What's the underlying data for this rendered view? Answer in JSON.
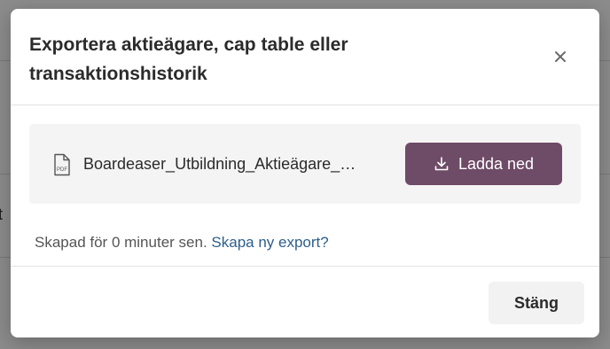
{
  "background": {
    "partial_text": "t"
  },
  "dialog": {
    "title": "Exportera aktieägare, cap table eller transaktionshistorik",
    "close_icon": "close-icon"
  },
  "file": {
    "name": "Boardeaser_Utbildning_Aktieägare_…",
    "icon": "pdf-file-icon",
    "icon_label": "PDF",
    "download_label": "Ladda ned",
    "download_icon": "download-icon"
  },
  "status": {
    "created_text": "Skapad för 0 minuter sen.",
    "new_export_link": "Skapa ny export?"
  },
  "footer": {
    "close_label": "Stäng"
  },
  "colors": {
    "primary_button": "#6e4b66",
    "link": "#2d5e8a",
    "card_bg": "#f4f4f4",
    "secondary_button": "#f2f2f2"
  }
}
